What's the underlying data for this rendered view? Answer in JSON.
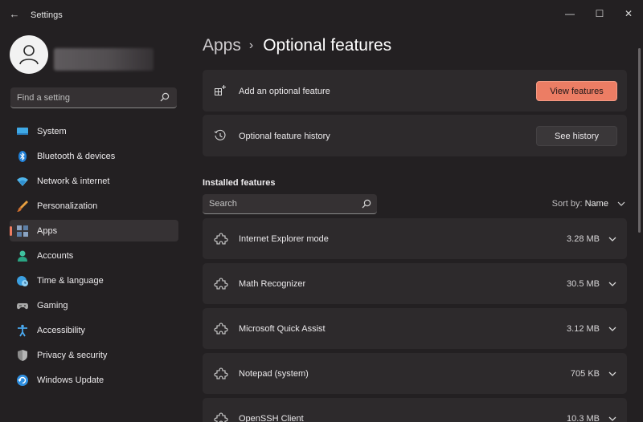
{
  "window": {
    "title": "Settings",
    "minimize": "—",
    "maximize": "☐",
    "close": "✕"
  },
  "sidebar": {
    "search_placeholder": "Find a setting",
    "items": [
      {
        "label": "System",
        "icon": "system-icon",
        "active": false
      },
      {
        "label": "Bluetooth & devices",
        "icon": "bluetooth-icon",
        "active": false
      },
      {
        "label": "Network & internet",
        "icon": "wifi-icon",
        "active": false
      },
      {
        "label": "Personalization",
        "icon": "brush-icon",
        "active": false
      },
      {
        "label": "Apps",
        "icon": "apps-icon",
        "active": true
      },
      {
        "label": "Accounts",
        "icon": "accounts-icon",
        "active": false
      },
      {
        "label": "Time & language",
        "icon": "globe-clock-icon",
        "active": false
      },
      {
        "label": "Gaming",
        "icon": "gamepad-icon",
        "active": false
      },
      {
        "label": "Accessibility",
        "icon": "accessibility-icon",
        "active": false
      },
      {
        "label": "Privacy & security",
        "icon": "shield-icon",
        "active": false
      },
      {
        "label": "Windows Update",
        "icon": "update-icon",
        "active": false
      }
    ]
  },
  "header": {
    "breadcrumb_root": "Apps",
    "breadcrumb_sep": "›",
    "page_title": "Optional features"
  },
  "cards": {
    "add": {
      "label": "Add an optional feature",
      "button": "View features"
    },
    "history": {
      "label": "Optional feature history",
      "button": "See history"
    }
  },
  "installed": {
    "title": "Installed features",
    "search_placeholder": "Search",
    "sort_label": "Sort by:",
    "sort_value": "Name",
    "features": [
      {
        "name": "Internet Explorer mode",
        "size": "3.28 MB"
      },
      {
        "name": "Math Recognizer",
        "size": "30.5 MB"
      },
      {
        "name": "Microsoft Quick Assist",
        "size": "3.12 MB"
      },
      {
        "name": "Notepad (system)",
        "size": "705 KB"
      },
      {
        "name": "OpenSSH Client",
        "size": "10.3 MB"
      }
    ]
  },
  "colors": {
    "accent": "#ec7d64",
    "background": "#232022",
    "card": "#2d2a2c"
  }
}
